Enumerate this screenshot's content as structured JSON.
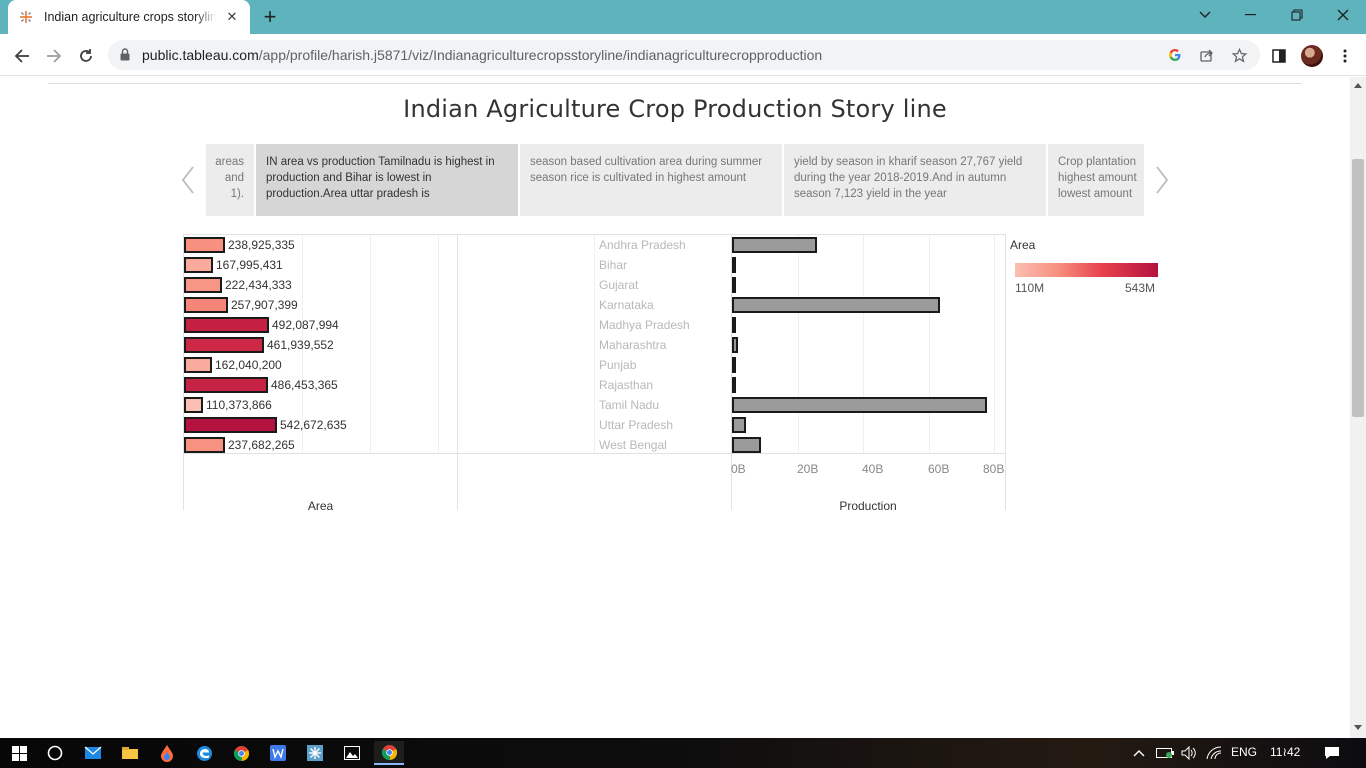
{
  "browser": {
    "tab_title": "Indian agriculture crops storyline",
    "url_host": "public.tableau.com",
    "url_path": "/app/profile/harish.j5871/viz/Indianagriculturecropsstoryline/indianagriculturecropproduction"
  },
  "story": {
    "title": "Indian Agriculture Crop Production Story line",
    "points": [
      {
        "text": "areas\nand\n1)."
      },
      {
        "text": "IN area vs production  Tamilnadu is highest in production and Bihar is lowest in production.Area uttar pradesh is"
      },
      {
        "text": "season based cultivation area during summer season rice is cultivated in highest amount"
      },
      {
        "text": "yield by season in kharif season 27,767 yield during the year 2018-2019.And in autumn season 7,123 yield in the year"
      },
      {
        "text": "Crop plantation\nhighest amount\nlowest amount"
      }
    ]
  },
  "colors": {
    "area_low": "#fbbfb3",
    "area_high": "#b5123f",
    "production_bar": "#9b9b9b",
    "active_story_point": "#d6d6d6"
  },
  "chart_data": [
    {
      "type": "bar",
      "orientation": "horizontal",
      "xlabel": "Area",
      "categories": [
        "Andhra Pradesh",
        "Bihar",
        "Gujarat",
        "Karnataka",
        "Madhya Pradesh",
        "Maharashtra",
        "Punjab",
        "Rajasthan",
        "Tamil Nadu",
        "Uttar Pradesh",
        "West Bengal"
      ],
      "values": [
        238925335,
        167995431,
        222434333,
        257907399,
        492087994,
        461939552,
        162040200,
        486453365,
        110373866,
        542672635,
        237682265
      ],
      "labels": [
        "238,925,335",
        "167,995,431",
        "222,434,333",
        "257,907,399",
        "492,087,994",
        "461,939,552",
        "162,040,200",
        "486,453,365",
        "110,373,866",
        "542,672,635",
        "237,682,265"
      ],
      "color_legend": {
        "title": "Area",
        "min_label": "110M",
        "max_label": "543M",
        "min": 110373866,
        "max": 542672635
      }
    },
    {
      "type": "bar",
      "orientation": "horizontal",
      "xlabel": "Production",
      "categories": [
        "Andhra Pradesh",
        "Bihar",
        "Gujarat",
        "Karnataka",
        "Madhya Pradesh",
        "Maharashtra",
        "Punjab",
        "Rajasthan",
        "Tamil Nadu",
        "Uttar Pradesh",
        "West Bengal"
      ],
      "values": [
        26000000000,
        400000000,
        800000000,
        63500000000,
        800000000,
        1700000000,
        900000000,
        400000000,
        78000000000,
        4400000000,
        9000000000
      ],
      "xlim": [
        0,
        80000000000
      ],
      "ticks": [
        "0B",
        "20B",
        "40B",
        "60B",
        "80B"
      ]
    }
  ],
  "taskbar": {
    "language": "ENG",
    "time": "11≀42"
  }
}
